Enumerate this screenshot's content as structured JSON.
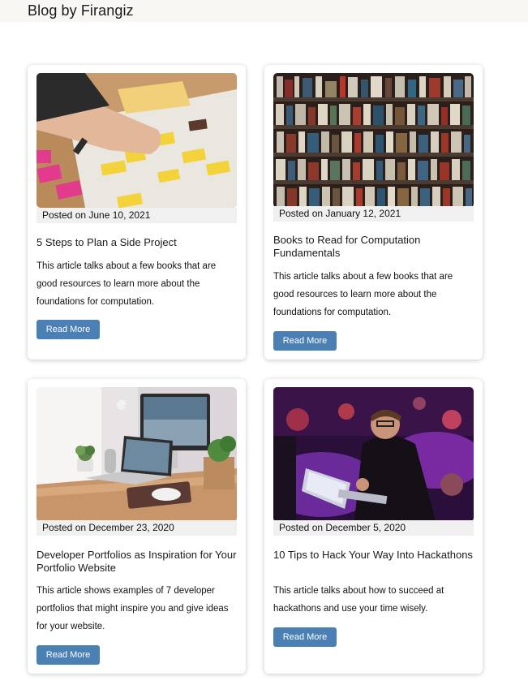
{
  "header": {
    "title": "Blog by Firangiz"
  },
  "posts": [
    {
      "image": "planning-sticky-notes-photo",
      "date": "Posted on June 10, 2021",
      "title": "5 Steps to Plan a Side Project",
      "description": "This article talks about a few books that are good resources to learn more about the foundations for computation.",
      "button": "Read More"
    },
    {
      "image": "bookshelf-photo",
      "date": "Posted on January 12, 2021",
      "title": "Books to Read for Computation Fundamentals",
      "description": "This article talks about a few books that are good resources to learn more about the foundations for computation.",
      "button": "Read More"
    },
    {
      "image": "desk-computer-photo",
      "date": "Posted on December 23, 2020",
      "title": "Developer Portfolios as Inspiration for Your Portfolio Website",
      "description": "This article shows examples of 7 developer portfolios that might inspire you and give ideas for your website.",
      "button": "Read More"
    },
    {
      "image": "hackathon-laptop-photo",
      "date": "Posted on December 5, 2020",
      "title": "10 Tips to Hack Your Way Into Hackathons",
      "description": "This article talks about how to succeed at hackathons and use your time wisely.",
      "button": "Read More"
    }
  ],
  "colors": {
    "button": "#4a80b4",
    "date_strip": "#f0f0f0",
    "topbar": "#f8f7f3"
  }
}
